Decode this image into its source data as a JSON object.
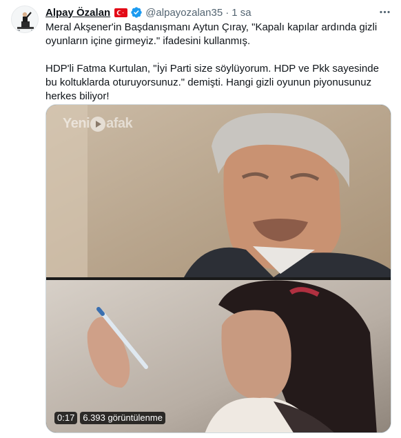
{
  "tweet": {
    "author_name": "Alpay Özalan",
    "handle": "@alpayozalan35",
    "separator": "·",
    "time": "1 sa",
    "paragraphs": [
      "Meral Akşener'in Başdanışmanı Aytun Çıray, \"Kapalı kapılar ardında gizli oyunların içine girmeyiz.\" ifadesini kullanmış.",
      "HDP'li Fatma Kurtulan, \"İyi Parti size söylüyorum. HDP ve Pkk sayesinde bu koltuklarda oturuyorsunuz.\" demişti. Hangi gizli oyunun piyonusunuz herkes biliyor!"
    ],
    "icons": {
      "flag": "turkey-flag-icon",
      "verified": "verified-badge-icon",
      "more": "more-options-icon"
    }
  },
  "video": {
    "watermark_prefix": "Yeni",
    "watermark_suffix": "afak",
    "duration": "0:17",
    "views": "6.393 görüntülenme"
  },
  "colors": {
    "text": "#0f1419",
    "secondary": "#536471",
    "verified": "#1d9bf0",
    "flag_red": "#e30a17",
    "border": "#cfd9de"
  }
}
